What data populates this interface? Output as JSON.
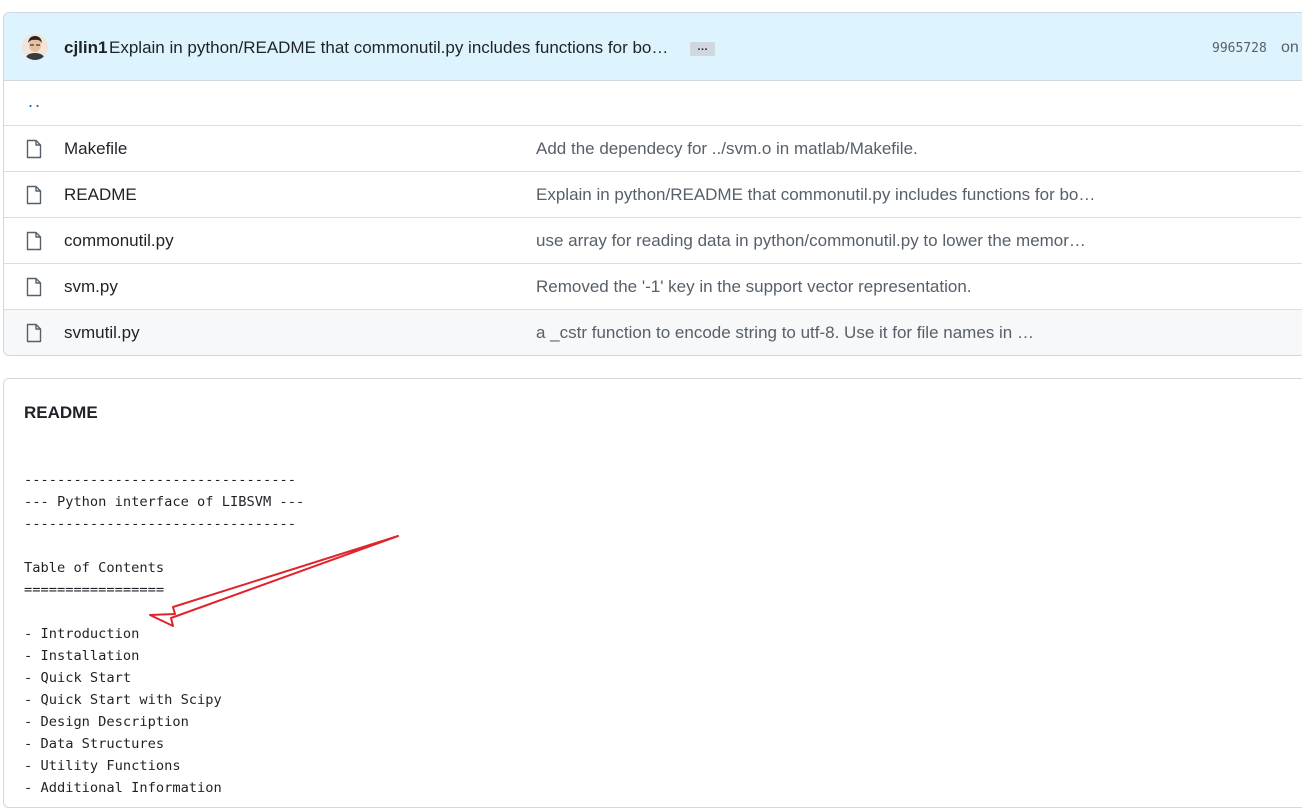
{
  "commit": {
    "author": "cjlin1",
    "message": "Explain in python/README that commonutil.py includes functions for bo…",
    "ellipsis": "…",
    "sha": "9965728",
    "on_text": "on"
  },
  "parent_link": "..",
  "files": [
    {
      "name": "Makefile",
      "commit": "Add the dependecy for ../svm.o in matlab/Makefile."
    },
    {
      "name": "README",
      "commit": "Explain in python/README that commonutil.py includes functions for bo…"
    },
    {
      "name": "commonutil.py",
      "commit": "use array for reading data in python/commonutil.py to lower the memor…"
    },
    {
      "name": "svm.py",
      "commit": "Removed the '-1' key in the support vector representation."
    },
    {
      "name": "svmutil.py",
      "commit": "a _cstr function to encode string to utf-8. Use it for file names in …"
    }
  ],
  "readme": {
    "title": "README",
    "lines": [
      "---------------------------------",
      "--- Python interface of LIBSVM ---",
      "---------------------------------",
      "",
      "Table of Contents",
      "=================",
      "",
      "- Introduction",
      "- Installation",
      "- Quick Start",
      "- Quick Start with Scipy",
      "- Design Description",
      "- Data Structures",
      "- Utility Functions",
      "- Additional Information"
    ]
  },
  "annotation": {
    "arrow_color": "#e0242b",
    "description": "red-arrow-pointing-to-introduction"
  },
  "icons": {
    "file": "file-icon",
    "avatar": "avatar"
  }
}
